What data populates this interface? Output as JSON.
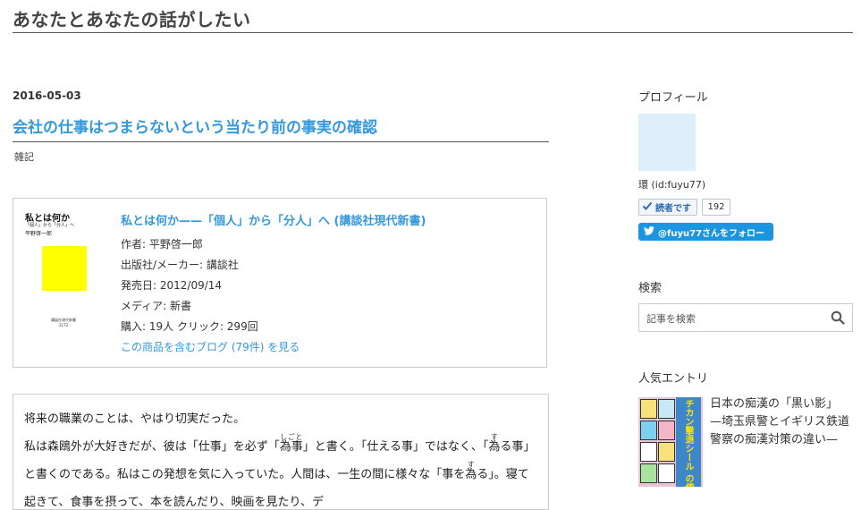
{
  "blog": {
    "title": "あなたとあなたの話がしたい"
  },
  "entry": {
    "date": "2016-05-03",
    "title": "会社の仕事はつまらないという当たり前の事実の確認",
    "category": "雑記"
  },
  "product": {
    "cover": {
      "title": "私とは何か",
      "subtitle": "「個人」から「分人」へ",
      "author": "平野啓一郎",
      "publisher_line1": "講談社現代新書",
      "publisher_line2": "2172"
    },
    "title": "私とは何か——「個人」から「分人」へ (講談社現代新書)",
    "author": "作者: 平野啓一郎",
    "maker": "出版社/メーカー: 講談社",
    "release": "発売日: 2012/09/14",
    "media": "メディア: 新書",
    "stats": "購入: 19人 クリック: 299回",
    "blog_link": "この商品を含むブログ (79件) を見る"
  },
  "body": {
    "p1": "将来の職業のことは、やはり切実だった。",
    "p2_a": "私は森鴎外が大好きだが、彼は「仕事」を必ず「",
    "p2_ruby1_base": "為事",
    "p2_ruby1_rt": "しごと",
    "p2_b": "」と書く。「仕える事」ではなく、「",
    "p2_ruby2_base": "為",
    "p2_ruby2_rt": "す",
    "p2_c": "る事」と書くのである。私はこの発想を気に入っていた。人間は、一生の間に様々な「事を",
    "p2_ruby3_base": "為",
    "p2_ruby3_rt": "す",
    "p2_d": "る」。寝て起きて、食事を摂って、本を読んだり、映画を見たり、デ"
  },
  "sidebar": {
    "profile": {
      "heading": "プロフィール",
      "id": "環 (id:fuyu77)",
      "reader_label": "読者です",
      "reader_count": "192",
      "twitter_label": "@fuyu77さんをフォロー"
    },
    "search": {
      "heading": "検索",
      "placeholder": "記事を検索"
    },
    "popular": {
      "heading": "人気エントリ",
      "thumb_text": "チカン撃退シール の使い方",
      "items": [
        {
          "title": "日本の痴漢の「黒い影」　—埼玉県警とイギリス鉄道警察の痴漢対策の違い—"
        }
      ]
    }
  },
  "colors": {
    "link": "#3598db",
    "twitter": "#1b95e0",
    "book_square": "#ffff00",
    "profile_placeholder": "#dfeefb"
  }
}
